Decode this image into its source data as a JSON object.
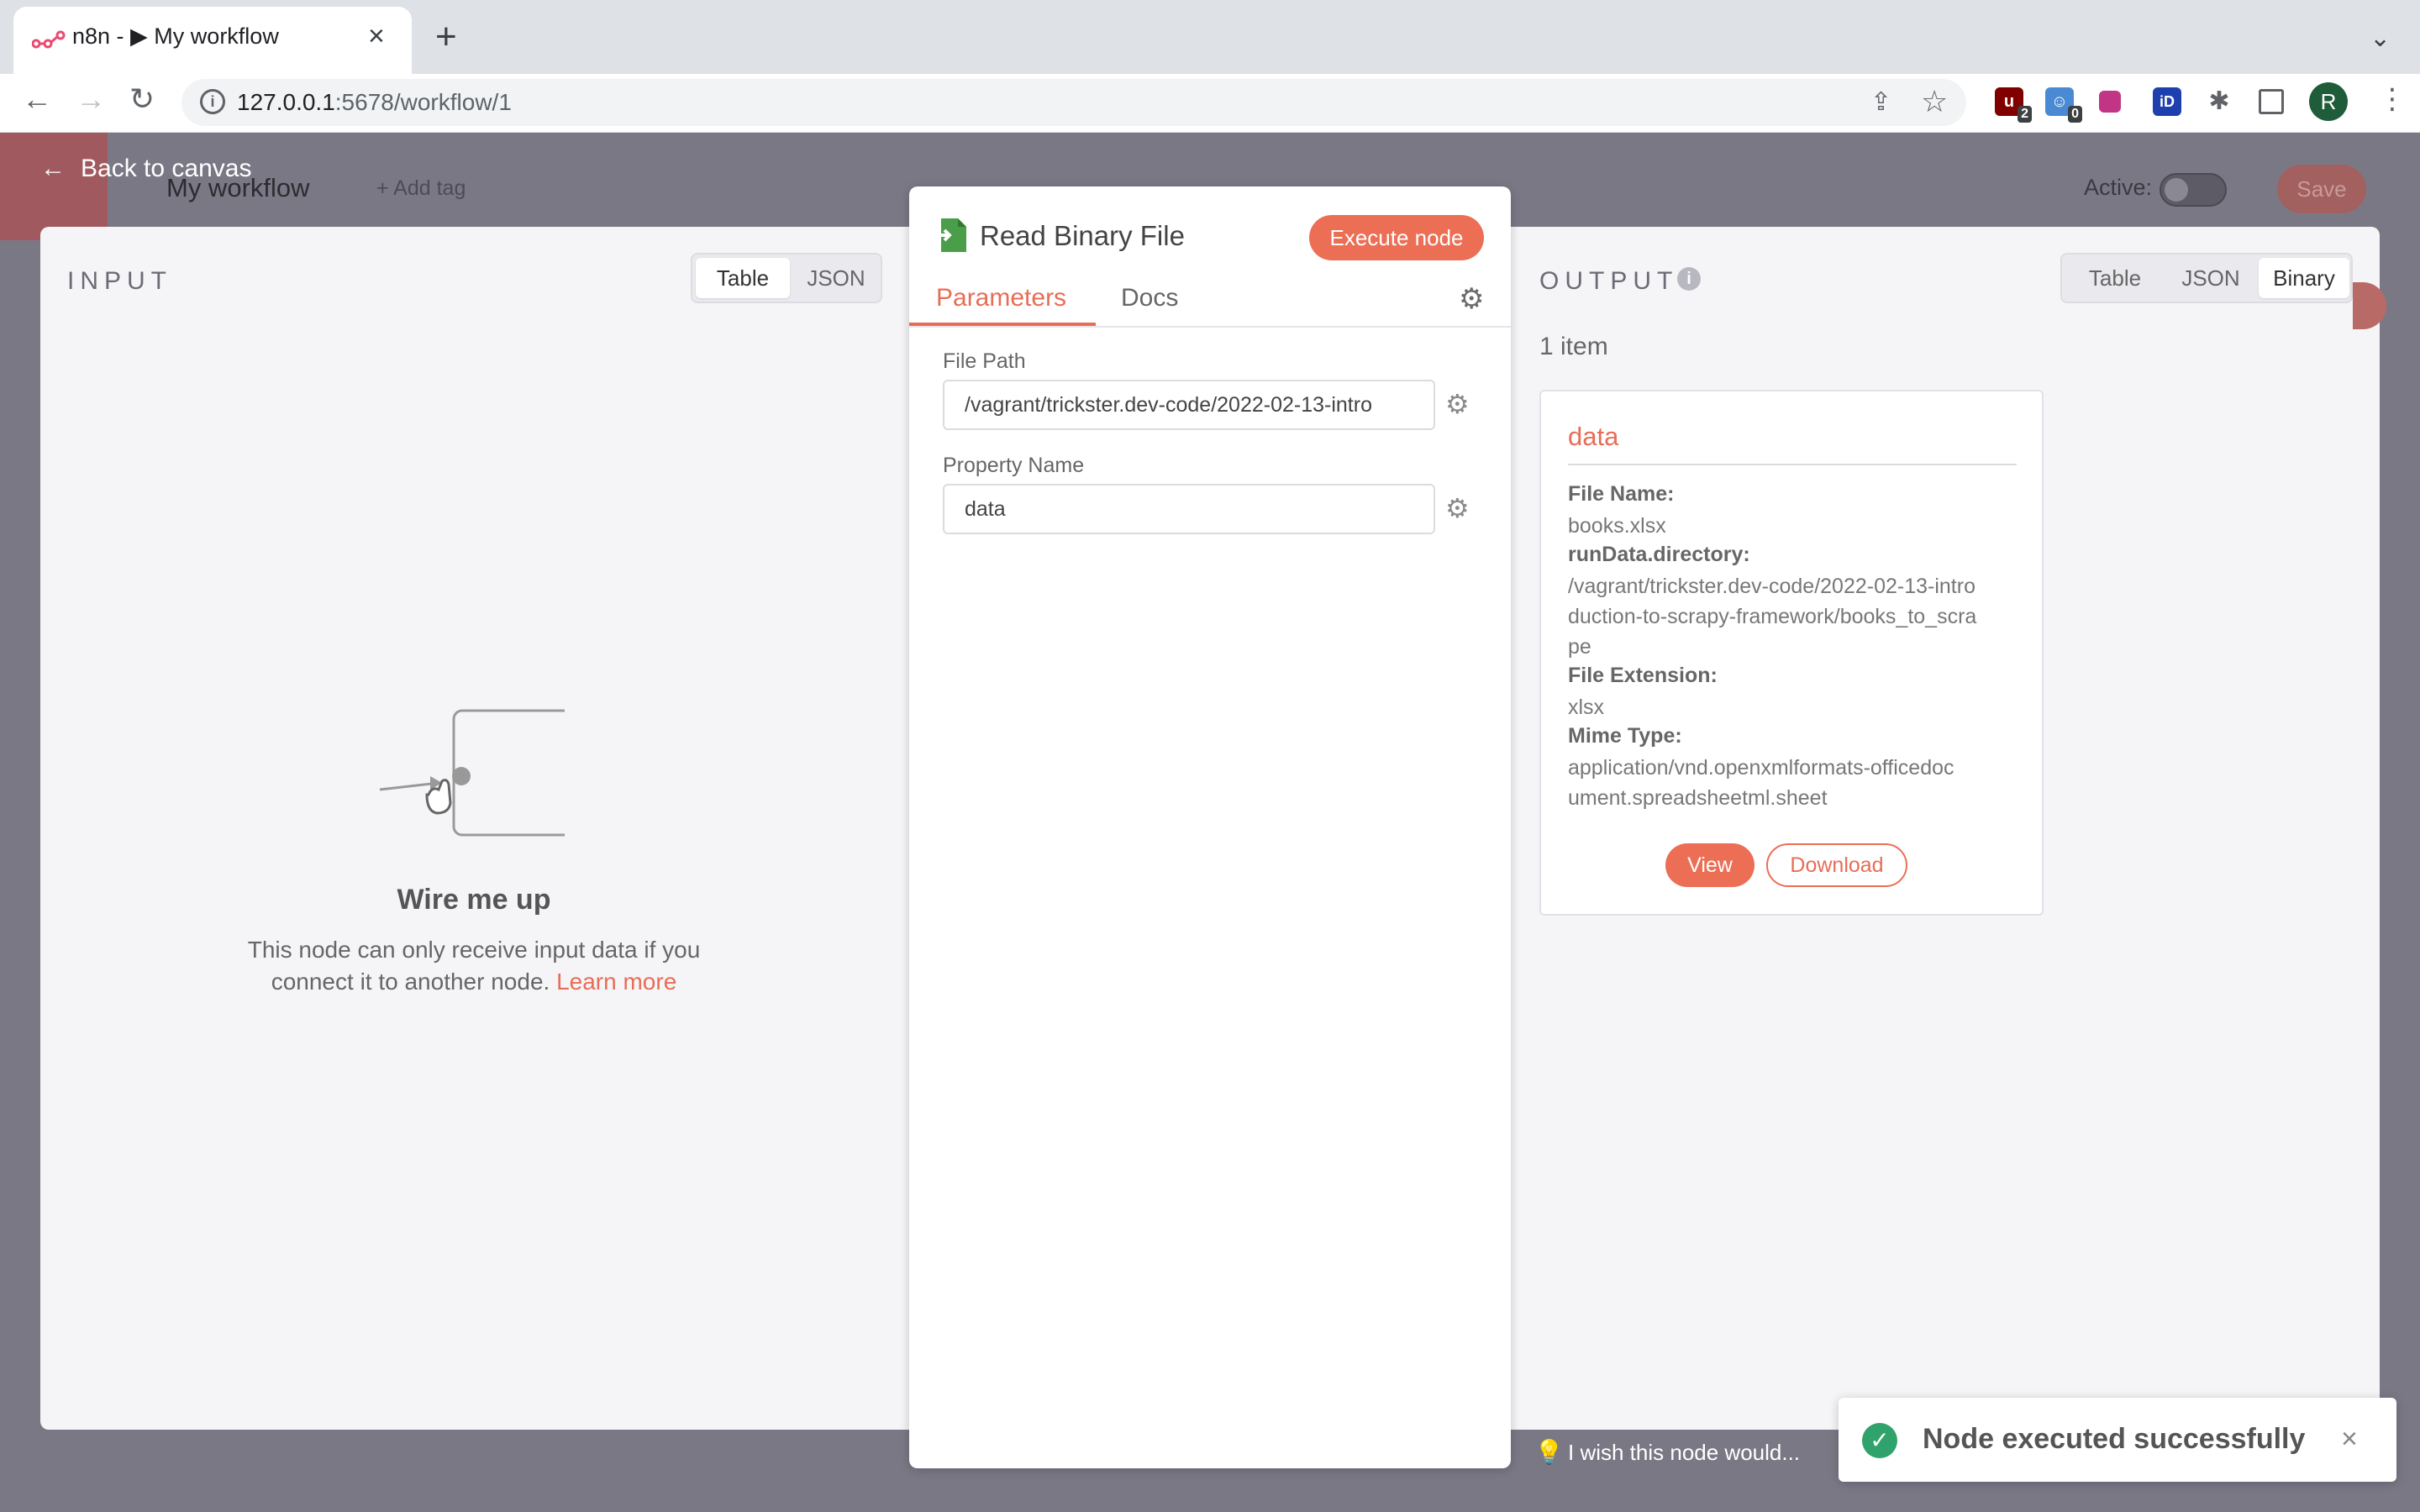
{
  "browser": {
    "tab_title": "n8n - ▶ My workflow",
    "url_host": "127.0.0.1",
    "url_rest": ":5678/workflow/1",
    "ext_badge_1": "2",
    "ext_badge_2": "0",
    "ext_id_label": "iD",
    "avatar_letter": "R"
  },
  "app": {
    "back_label": "Back to canvas",
    "workflow_name": "My workflow",
    "add_tag": "+ Add tag",
    "active_label": "Active:",
    "save_label": "Save"
  },
  "input": {
    "title": "INPUT",
    "view_table": "Table",
    "view_json": "JSON",
    "empty_title": "Wire me up",
    "empty_text": "This node can only receive input data if you connect it to another node.",
    "learn_more": "Learn more"
  },
  "node": {
    "title": "Read Binary File",
    "execute_label": "Execute node",
    "tab_parameters": "Parameters",
    "tab_docs": "Docs",
    "file_path_label": "File Path",
    "file_path_value": "/vagrant/trickster.dev-code/2022-02-13-intro",
    "property_name_label": "Property Name",
    "property_name_value": "data"
  },
  "output": {
    "title": "OUTPUT",
    "view_table": "Table",
    "view_json": "JSON",
    "view_binary": "Binary",
    "item_count": "1 item",
    "binary": {
      "name": "data",
      "file_name_label": "File Name:",
      "file_name": "books.xlsx",
      "directory_label": "runData.directory:",
      "directory": "/vagrant/trickster.dev-code/2022-02-13-introduction-to-scrapy-framework/books_to_scrape",
      "extension_label": "File Extension:",
      "extension": "xlsx",
      "mime_label": "Mime Type:",
      "mime": "application/vnd.openxmlformats-officedocument.spreadsheetml.sheet",
      "view_label": "View",
      "download_label": "Download"
    }
  },
  "footer": {
    "wish_text": "I wish this node would..."
  },
  "toast": {
    "message": "Node executed successfully"
  }
}
